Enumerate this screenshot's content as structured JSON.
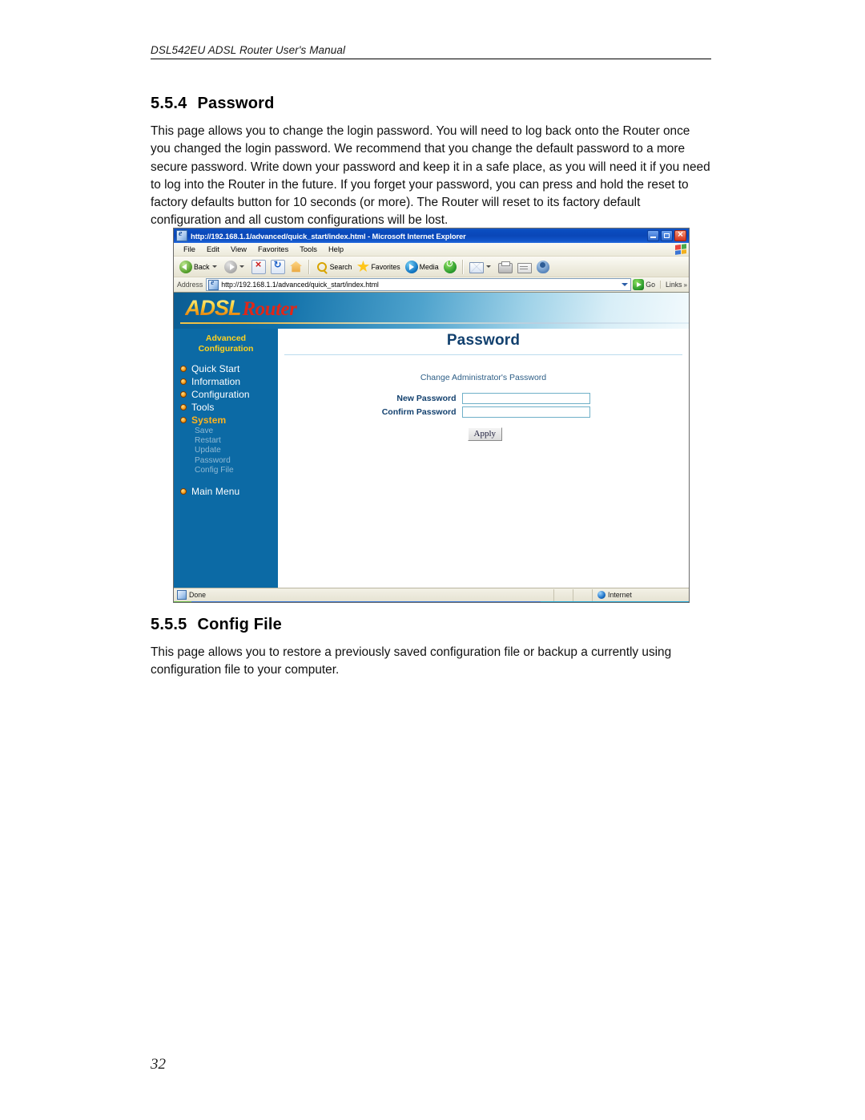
{
  "document": {
    "header": "DSL542EU ADSL Router User's Manual",
    "page_number": "32",
    "sections": [
      {
        "number": "5.5.4",
        "title": "Password",
        "body": "This page allows you to change the login password. You will need to log back onto the Router once you changed the login password. We recommend that you change the default password to a more secure password. Write down your password and keep it in a safe place, as you will need it if you need to log into the Router in the future. If you forget your password, you can press and hold the reset to factory defaults button for 10 seconds (or more). The Router will reset to its factory default configuration and all custom configurations will be lost."
      },
      {
        "number": "5.5.5",
        "title": "Config File",
        "body": "This page allows you to restore a previously saved configuration file or backup a currently using configuration file to your computer."
      }
    ]
  },
  "browser": {
    "title": "http://192.168.1.1/advanced/quick_start/index.html - Microsoft Internet Explorer",
    "window_buttons": {
      "minimize": "Minimize",
      "maximize": "Restore",
      "close": "Close"
    },
    "menu": [
      {
        "label": "File"
      },
      {
        "label": "Edit"
      },
      {
        "label": "View"
      },
      {
        "label": "Favorites"
      },
      {
        "label": "Tools"
      },
      {
        "label": "Help"
      }
    ],
    "toolbar": {
      "back": "Back",
      "forward": "",
      "stop": "",
      "refresh": "",
      "home": "",
      "search": "Search",
      "favorites": "Favorites",
      "media": "Media",
      "history": "",
      "mail": "",
      "print": "",
      "edit": "",
      "messenger": ""
    },
    "address": {
      "label": "Address",
      "value": "http://192.168.1.1/advanced/quick_start/index.html",
      "go": "Go",
      "links": "Links"
    },
    "status": {
      "text": "Done",
      "zone": "Internet"
    }
  },
  "router_ui": {
    "logo": {
      "adsl": "ADSL",
      "router": "Router"
    },
    "sidebar": {
      "title_line1": "Advanced",
      "title_line2": "Configuration",
      "items": [
        {
          "label": "Quick Start",
          "active": false
        },
        {
          "label": "Information",
          "active": false
        },
        {
          "label": "Configuration",
          "active": false
        },
        {
          "label": "Tools",
          "active": false
        },
        {
          "label": "System",
          "active": true
        }
      ],
      "sub_items": [
        {
          "label": "Save"
        },
        {
          "label": "Restart"
        },
        {
          "label": "Update"
        },
        {
          "label": "Password"
        },
        {
          "label": "Config File"
        }
      ],
      "main_menu": "Main Menu"
    },
    "page": {
      "title": "Password",
      "form_caption": "Change Administrator's Password",
      "fields": [
        {
          "label": "New Password",
          "value": ""
        },
        {
          "label": "Confirm Password",
          "value": ""
        }
      ],
      "apply_button": "Apply"
    }
  },
  "colors": {
    "sidebar_blue": "#0c6aa5",
    "accent_gold": "#ffd21e",
    "active_orange": "#ffb31e",
    "title_navy": "#12406e",
    "logo_red": "#e02718",
    "titlebar_blue": "#0a47b8"
  }
}
